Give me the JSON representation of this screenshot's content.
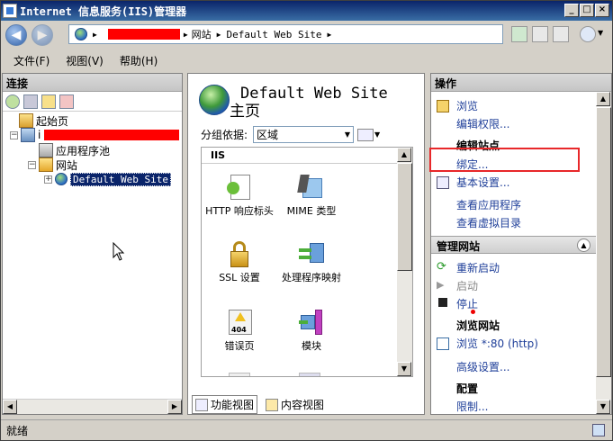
{
  "window": {
    "title": "Internet 信息服务(IIS)管理器"
  },
  "address": {
    "sep1": "▶",
    "crumb_sites": "网站",
    "sep2": "▶",
    "crumb_site": "Default Web Site",
    "sep3": "▶"
  },
  "menu": {
    "file": "文件(F)",
    "view": "视图(V)",
    "help": "帮助(H)"
  },
  "connections": {
    "header": "连接",
    "tree": {
      "start_page": "起始页",
      "server_prefix": "i",
      "app_pools": "应用程序池",
      "sites": "网站",
      "default_site": "Default Web Site"
    }
  },
  "center": {
    "title_line1": "Default Web Site",
    "title_line2": "主页",
    "group_label": "分组依据:",
    "group_value": "区域",
    "section": "IIS",
    "features": [
      {
        "label": "HTTP 响应标头"
      },
      {
        "label": "MIME 类型"
      },
      {
        "label": "SSL 设置"
      },
      {
        "label": "处理程序映射"
      },
      {
        "label": "错误页"
      },
      {
        "label": "模块"
      }
    ],
    "error_icon_text": "404",
    "tab_features": "功能视图",
    "tab_content": "内容视图"
  },
  "actions": {
    "header": "操作",
    "browse": "浏览",
    "edit_permissions": "编辑权限...",
    "edit_site_header": "编辑站点",
    "bindings": "绑定...",
    "basic_settings": "基本设置...",
    "view_apps": "查看应用程序",
    "view_vdirs": "查看虚拟目录",
    "manage_site_header": "管理网站",
    "restart": "重新启动",
    "start": "启动",
    "stop": "停止",
    "browse_site_header": "浏览网站",
    "browse_80": "浏览 *:80 (http)",
    "advanced_settings": "高级设置...",
    "config_header": "配置",
    "limits": "限制..."
  },
  "status": {
    "text": "就绪"
  },
  "colors": {
    "highlight_box": "#e8282a",
    "link": "#1f3f99"
  }
}
